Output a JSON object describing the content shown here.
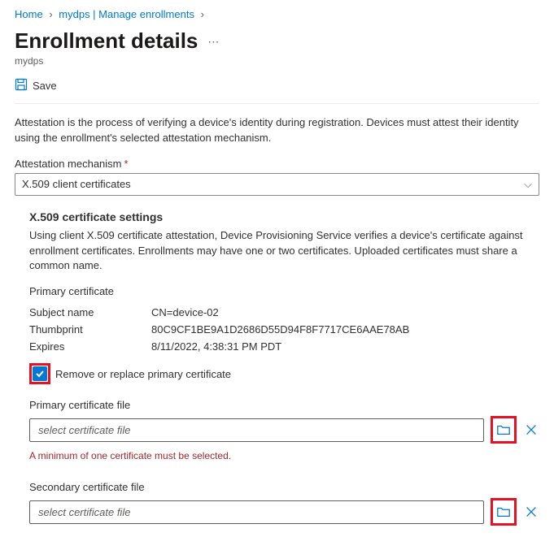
{
  "breadcrumbs": {
    "home": "Home",
    "resource": "mydps | Manage enrollments"
  },
  "page": {
    "title": "Enrollment details",
    "subtitle": "mydps"
  },
  "toolbar": {
    "save": "Save"
  },
  "attestation_desc": "Attestation is the process of verifying a device's identity during registration. Devices must attest their identity using the enrollment's selected attestation mechanism.",
  "mechanism": {
    "label": "Attestation mechanism",
    "value": "X.509 client certificates"
  },
  "x509": {
    "heading": "X.509 certificate settings",
    "desc": "Using client X.509 certificate attestation, Device Provisioning Service verifies a device's certificate against enrollment certificates. Enrollments may have one or two certificates. Uploaded certificates must share a common name.",
    "primary_label": "Primary certificate",
    "subject_name_label": "Subject name",
    "subject_name_value": "CN=device-02",
    "thumbprint_label": "Thumbprint",
    "thumbprint_value": "80C9CF1BE9A1D2686D55D94F8F7717CE6AAE78AB",
    "expires_label": "Expires",
    "expires_value": "8/11/2022, 4:38:31 PM PDT",
    "remove_replace_label": "Remove or replace primary certificate",
    "primary_file_label": "Primary certificate file",
    "secondary_file_label": "Secondary certificate file",
    "file_placeholder": "select certificate file",
    "error": "A minimum of one certificate must be selected."
  }
}
